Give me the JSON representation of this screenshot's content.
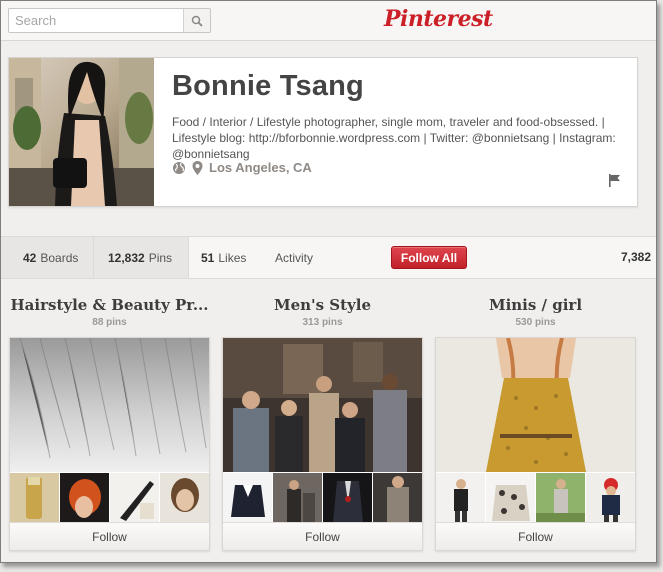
{
  "header": {
    "search_placeholder": "Search",
    "logo_text": "Pinterest",
    "brand_color": "#cb2027"
  },
  "profile": {
    "name": "Bonnie Tsang",
    "bio": "Food / Interior / Lifestyle photographer, single mom, traveler and food-obsessed. | Lifestyle blog: http://bforbonnie.wordpress.com | Twitter: @bonnietsang | Instagram: @bonnietsang",
    "location": "Los Angeles, CA"
  },
  "tabs": [
    {
      "count": "42",
      "label": "Boards"
    },
    {
      "count": "12,832",
      "label": "Pins"
    },
    {
      "count": "51",
      "label": "Likes"
    },
    {
      "count": "",
      "label": "Activity"
    }
  ],
  "follow_all_label": "Follow All",
  "right_count": "7,382",
  "boards": [
    {
      "title": "Hairstyle & Beauty Pr...",
      "count": "88 pins",
      "follow_label": "Follow"
    },
    {
      "title": "Men's Style",
      "count": "313 pins",
      "follow_label": "Follow"
    },
    {
      "title": "Minis / girl",
      "count": "530 pins",
      "follow_label": "Follow"
    }
  ],
  "icons": {
    "search": "search-icon",
    "globe": "globe-icon",
    "location": "location-pin-icon",
    "flag": "flag-icon"
  }
}
